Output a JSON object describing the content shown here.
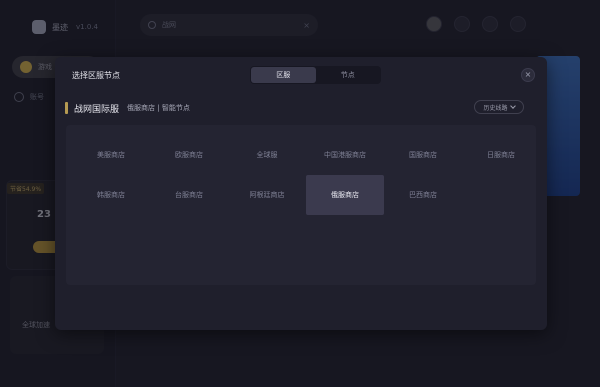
{
  "app": {
    "name": "墨迹",
    "version": "v1.0.4",
    "search_value": "战网",
    "rail_item_1": "游戏",
    "rail_item_2": "账号",
    "card_tag": "节省54.9%",
    "card_num": "23",
    "card_2_text": "全球加速"
  },
  "modal": {
    "title": "选择区服节点",
    "tabs": [
      {
        "label": "区服",
        "active": true
      },
      {
        "label": "节点",
        "active": false
      }
    ],
    "close_label": "×",
    "selected_game": "战网国际服",
    "selected_detail": "俄服商店 | 智能节点",
    "history_label": "历史线路",
    "regions": [
      {
        "label": "美服商店",
        "selected": false
      },
      {
        "label": "欧服商店",
        "selected": false
      },
      {
        "label": "全球服",
        "selected": false
      },
      {
        "label": "中国港服商店",
        "selected": false
      },
      {
        "label": "国服商店",
        "selected": false
      },
      {
        "label": "日服商店",
        "selected": false
      },
      {
        "label": "韩服商店",
        "selected": false
      },
      {
        "label": "台服商店",
        "selected": false
      },
      {
        "label": "阿根廷商店",
        "selected": false
      },
      {
        "label": "俄服商店",
        "selected": true
      },
      {
        "label": "巴西商店",
        "selected": false
      }
    ]
  },
  "colors": {
    "accent_gold": "#b59a52",
    "modal_bg": "#1f1f2c",
    "selected_cell": "#3b3a4e"
  }
}
